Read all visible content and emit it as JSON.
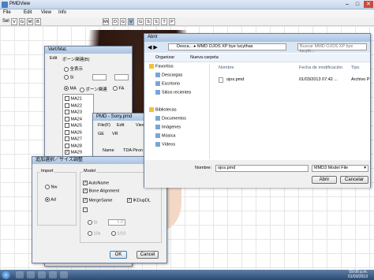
{
  "app": {
    "title": "PMDView",
    "menu": [
      "File",
      "Edit",
      "View",
      "Info"
    ],
    "sel_label": "Sel",
    "toolbar_keys": [
      "V",
      "G",
      "M",
      "B",
      "Mt",
      "D",
      "G",
      "V",
      "G",
      "S",
      "S",
      "T",
      "P"
    ],
    "toolbar_active": "V"
  },
  "vertmat": {
    "title": "Vert/Mat.",
    "menu": [
      "Edit",
      "ボーン関連(B)"
    ],
    "filters": [
      "全表示",
      "Si",
      "MA",
      "ボーン関連",
      "FA"
    ],
    "filter_active": "MA",
    "items": [
      "MA21",
      "MA22",
      "MA23",
      "MA24",
      "MA25",
      "MA26",
      "MA27",
      "MA28",
      "MA29",
      "MA30",
      "MA31",
      "MA32",
      "MA33"
    ],
    "checked": [
      "MA29",
      "MA30",
      "MA31"
    ],
    "selected": "MA30"
  },
  "pmd": {
    "title": "PMD - Sony.pmd",
    "menu": [
      "File(F)",
      "Edit",
      "View"
    ],
    "tabs": [
      "GE",
      "VR"
    ],
    "name_label": "Name",
    "name_value": "TDA Piron bas"
  },
  "dialog": {
    "title": "追加選択／サイズ調整",
    "import_label": "Import",
    "import_opts": [
      "Nw",
      "Ad"
    ],
    "import_active": "Ad",
    "model_label": "Model",
    "model_opts": [
      {
        "label": "AutoName",
        "checked": true
      },
      {
        "label": "Bone Alignment",
        "checked": true
      },
      {
        "label": "MergeSame",
        "checked": true
      },
      {
        "label": "IKDupDL",
        "checked": true
      }
    ],
    "size_si": "Si",
    "size_si_value": "1.0",
    "size_10x": "10x",
    "size_1_10": "1/10",
    "ok": "OK",
    "cancel": "Cancel"
  },
  "explorer": {
    "title": "Abrir",
    "path": [
      "Desca...",
      "MMD OJOS XP bye lucythas"
    ],
    "search_placeholder": "Buscar MMD OJOS XP bye lucyth...",
    "organize": "Organizar",
    "new_folder": "Nueva carpeta",
    "nav": [
      {
        "label": "Favoritos",
        "icon": "star-icon"
      },
      {
        "label": "Descargas",
        "icon": "download-icon"
      },
      {
        "label": "Escritorio",
        "icon": "desktop-icon"
      },
      {
        "label": "Sitios recientes",
        "icon": "recent-icon"
      },
      {
        "label": "",
        "icon": ""
      },
      {
        "label": "Bibliotecas",
        "icon": "library-icon"
      },
      {
        "label": "Documentos",
        "icon": "document-icon"
      },
      {
        "label": "Imágenes",
        "icon": "image-icon"
      },
      {
        "label": "Música",
        "icon": "music-icon"
      },
      {
        "label": "Vídeos",
        "icon": "video-icon"
      }
    ],
    "columns": [
      "Nombre",
      "Fecha de modificación",
      "Tipo"
    ],
    "files": [
      {
        "name": "ojos.pmd",
        "date": "01/03/2013 07:42 ...",
        "type": "Archivo P"
      }
    ],
    "filename_label": "Nombre:",
    "filename_value": "ojos.pmd",
    "filetype": "MMD3 Model File",
    "open": "Abrir",
    "cancel": "Cancelar"
  },
  "taskbar": {
    "time": "09:06 p.m.",
    "date": "01/03/2013"
  }
}
